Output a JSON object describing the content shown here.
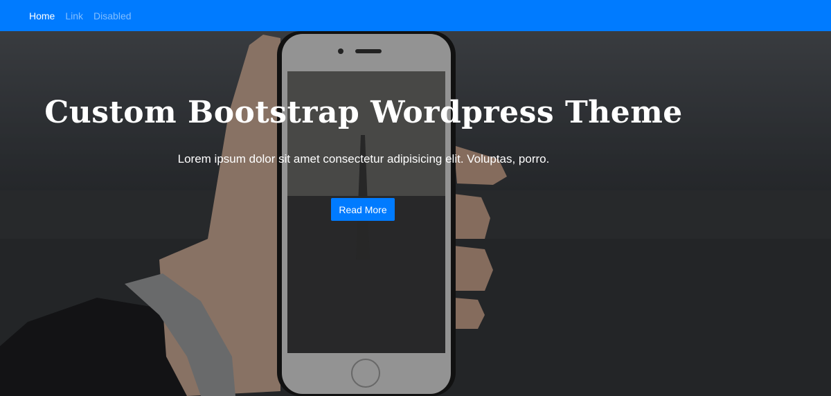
{
  "navbar": {
    "links": [
      {
        "label": "Home"
      },
      {
        "label": "Link"
      },
      {
        "label": "Disabled"
      }
    ]
  },
  "hero": {
    "title": "Custom Bootstrap Wordpress Theme",
    "subtitle": "Lorem ipsum dolor sit amet consectetur adipisicing elit. Voluptas, porro.",
    "button_label": "Read More"
  },
  "colors": {
    "primary": "#007bff",
    "text_light": "#ffffff"
  }
}
